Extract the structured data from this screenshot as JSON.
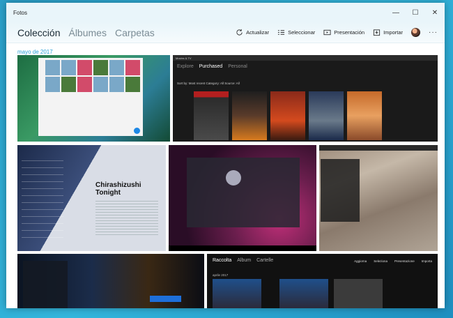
{
  "window": {
    "title": "Fotos",
    "controls": {
      "minimize": "—",
      "maximize": "☐",
      "close": "✕"
    }
  },
  "nav": {
    "tabs": [
      {
        "label": "Colección",
        "active": true
      },
      {
        "label": "Álbumes",
        "active": false
      },
      {
        "label": "Carpetas",
        "active": false
      }
    ]
  },
  "toolbar": {
    "refresh_label": "Actualizar",
    "select_label": "Seleccionar",
    "slideshow_label": "Presentación",
    "import_label": "Importar",
    "more_label": "···"
  },
  "section": {
    "date": "mayo de 2017"
  },
  "photos": {
    "ph2": {
      "app_title": "Movies & TV",
      "tabs": [
        "Explore",
        "Purchased",
        "Personal"
      ],
      "sort": "Sort by: Most recent   Category: All   Source: All"
    },
    "ph3": {
      "headline_1": "Chirashizushi",
      "headline_2": "Tonight"
    },
    "ph7": {
      "tabs": [
        "Raccolta",
        "Album",
        "Cartelle"
      ],
      "actions": [
        "Aggiorna",
        "Seleziona",
        "Presentazione",
        "Importa"
      ],
      "month": "aprile 2017"
    }
  },
  "colors": {
    "accent": "#2aa0d6",
    "titlebar_bg": "#e9f5fa",
    "window_bg": "#ffffff"
  }
}
